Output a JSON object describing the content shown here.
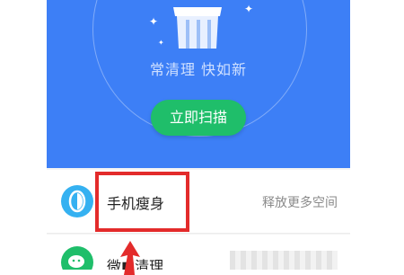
{
  "hero": {
    "tagline": "常清理 快如新",
    "scan_button": "立即扫描"
  },
  "features": [
    {
      "title": "手机瘦身",
      "description": "释放更多空间"
    },
    {
      "title": "微■清理"
    }
  ],
  "colors": {
    "hero_bg": "#3d7ff6",
    "scan_button": "#1fbe6a",
    "annotation": "#e32b2b"
  }
}
